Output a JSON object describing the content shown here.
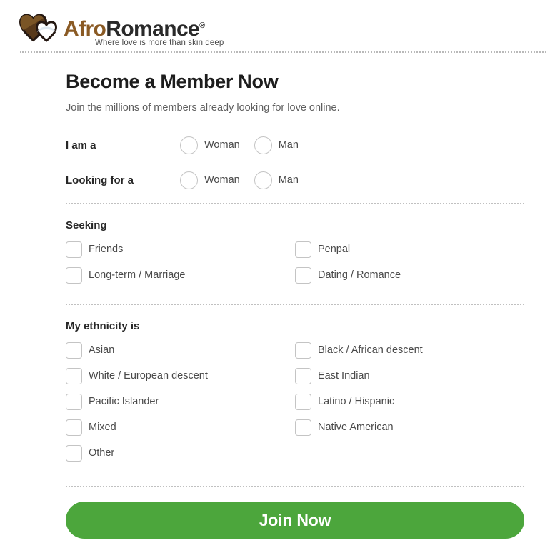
{
  "brand": {
    "name_part1": "Afro",
    "name_part2": "Romance",
    "registered_mark": "®",
    "tagline": "Where love is more than skin deep",
    "logo_icon": "two-hearts-icon",
    "brown_hex": "#8a5a24",
    "accent_green_hex": "#4ca63c"
  },
  "main": {
    "title": "Become a Member Now",
    "subtitle": "Join the millions of members already looking for love online."
  },
  "gender": {
    "rows": [
      {
        "label": "I am a",
        "options": [
          {
            "label": "Woman",
            "selected": false
          },
          {
            "label": "Man",
            "selected": false
          }
        ]
      },
      {
        "label": "Looking for a",
        "options": [
          {
            "label": "Woman",
            "selected": false
          },
          {
            "label": "Man",
            "selected": false
          }
        ]
      }
    ]
  },
  "seeking": {
    "title": "Seeking",
    "left": [
      {
        "label": "Friends",
        "checked": false
      },
      {
        "label": "Long-term / Marriage",
        "checked": false
      }
    ],
    "right": [
      {
        "label": "Penpal",
        "checked": false
      },
      {
        "label": "Dating / Romance",
        "checked": false
      }
    ]
  },
  "ethnicity": {
    "title": "My ethnicity is",
    "left": [
      {
        "label": "Asian",
        "checked": false
      },
      {
        "label": "White / European descent",
        "checked": false
      },
      {
        "label": "Pacific Islander",
        "checked": false
      },
      {
        "label": "Mixed",
        "checked": false
      },
      {
        "label": "Other",
        "checked": false
      }
    ],
    "right": [
      {
        "label": "Black / African descent",
        "checked": false
      },
      {
        "label": "East Indian",
        "checked": false
      },
      {
        "label": "Latino / Hispanic",
        "checked": false
      },
      {
        "label": "Native American",
        "checked": false
      }
    ]
  },
  "submit": {
    "label": "Join Now"
  }
}
